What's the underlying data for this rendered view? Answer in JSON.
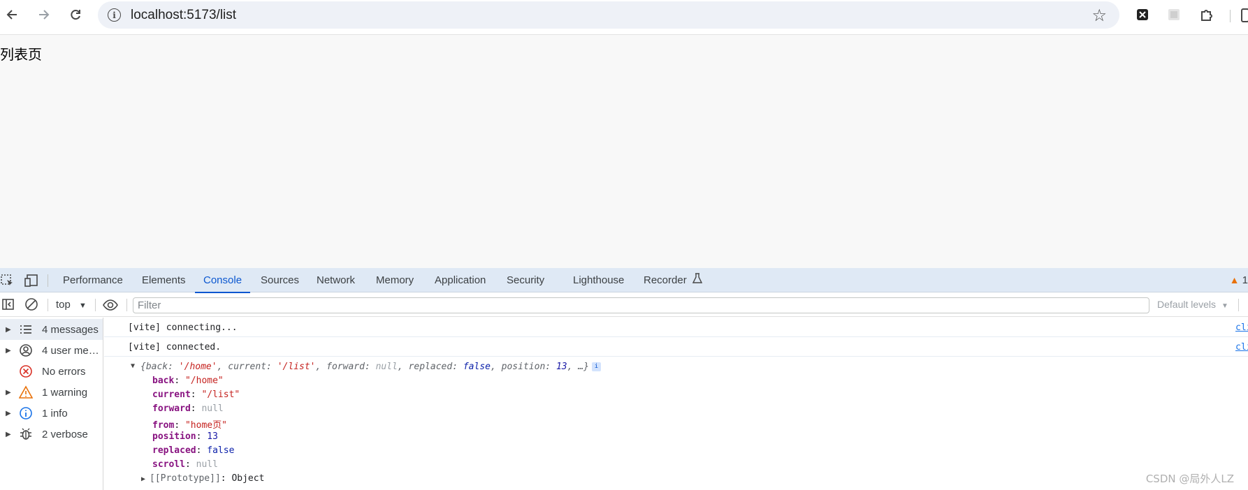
{
  "browser": {
    "url": "localhost:5173/list"
  },
  "page": {
    "heading": "列表页"
  },
  "devtools": {
    "tabs": [
      "Performance",
      "Elements",
      "Console",
      "Sources",
      "Network",
      "Memory",
      "Application",
      "Security",
      "Lighthouse",
      "Recorder"
    ],
    "active_tab": "Console",
    "issue_count": "1",
    "toolbar": {
      "context": "top",
      "filter_placeholder": "Filter",
      "levels": "Default levels"
    },
    "sidebar": [
      {
        "label": "4 messages",
        "icon": "list-icon"
      },
      {
        "label": "4 user mes…",
        "icon": "user-icon"
      },
      {
        "label": "No errors",
        "icon": "error-icon"
      },
      {
        "label": "1 warning",
        "icon": "warning-icon"
      },
      {
        "label": "1 info",
        "icon": "info-icon"
      },
      {
        "label": "2 verbose",
        "icon": "bug-icon"
      }
    ],
    "messages": [
      {
        "text": "[vite] connecting...",
        "source": "client"
      },
      {
        "text": "[vite] connected.",
        "source": "client"
      }
    ],
    "object_summary": {
      "open": "{",
      "back_key": "back",
      "back_val": "'/home'",
      "current_key": "current",
      "current_val": "'/list'",
      "forward_key": "forward",
      "forward_val": "null",
      "replaced_key": "replaced",
      "replaced_val": "false",
      "position_key": "position",
      "position_val": "13",
      "tail": "…}"
    },
    "object_props": [
      {
        "key": "back",
        "value": "\"/home\"",
        "kind": "s"
      },
      {
        "key": "current",
        "value": "\"/list\"",
        "kind": "s"
      },
      {
        "key": "forward",
        "value": "null",
        "kind": "nul"
      },
      {
        "key": "from",
        "value": "\"home页\"",
        "kind": "s"
      },
      {
        "key": "position",
        "value": "13",
        "kind": "n"
      },
      {
        "key": "replaced",
        "value": "false",
        "kind": "b"
      },
      {
        "key": "scroll",
        "value": "null",
        "kind": "nul"
      }
    ],
    "prototype": {
      "key": "[[Prototype]]",
      "value": "Object"
    }
  },
  "watermark": "CSDN @局外人LZ"
}
